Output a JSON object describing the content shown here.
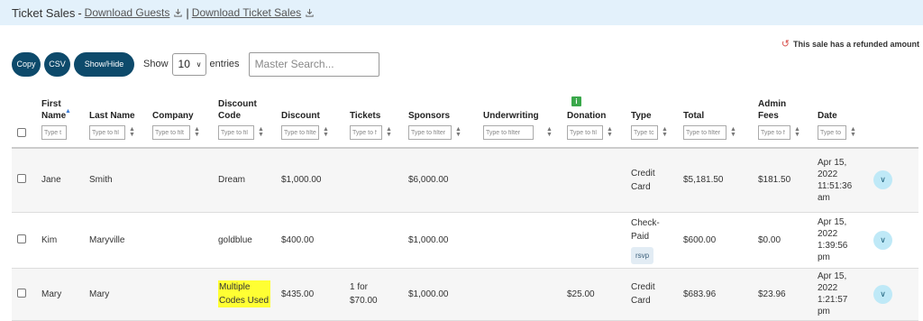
{
  "header": {
    "title": "Ticket Sales",
    "separator": " - ",
    "download_guests": "Download Guests",
    "pipe": "|",
    "download_ticket_sales": "Download Ticket Sales"
  },
  "refund_note": "This sale has a refunded amount",
  "toolbar": {
    "copy": "Copy",
    "csv": "CSV",
    "show_hide": "Show/Hide",
    "show_label": "Show",
    "entries_value": "10",
    "entries_label": "entries",
    "search_placeholder": "Master Search..."
  },
  "columns": [
    {
      "key": "first_name",
      "label": "First Name",
      "filter": "Type t"
    },
    {
      "key": "last_name",
      "label": "Last Name",
      "filter": "Type to fil"
    },
    {
      "key": "company",
      "label": "Company",
      "filter": "Type to filt"
    },
    {
      "key": "discount_code",
      "label": "Discount Code",
      "filter": "Type to fil"
    },
    {
      "key": "discount",
      "label": "Discount",
      "filter": "Type to filte"
    },
    {
      "key": "tickets",
      "label": "Tickets",
      "filter": "Type to f"
    },
    {
      "key": "sponsors",
      "label": "Sponsors",
      "filter": "Type to filter"
    },
    {
      "key": "underwriting",
      "label": "Underwriting",
      "filter": "Type to filter"
    },
    {
      "key": "donation",
      "label": "Donation",
      "filter": "Type to fil"
    },
    {
      "key": "type",
      "label": "Type",
      "filter": "Type tc"
    },
    {
      "key": "total",
      "label": "Total",
      "filter": "Type to filter"
    },
    {
      "key": "admin_fees",
      "label": "Admin Fees",
      "filter": "Type to f"
    },
    {
      "key": "date",
      "label": "Date",
      "filter": "Type to"
    }
  ],
  "rows": [
    {
      "first_name": "Jane",
      "last_name": "Smith",
      "company": "",
      "discount_code": "Dream",
      "discount": "$1,000.00",
      "tickets": "",
      "sponsors": "$6,000.00",
      "underwriting": "",
      "donation": "",
      "type": "Credit Card",
      "rsvp": "",
      "total": "$5,181.50",
      "admin_fees": "$181.50",
      "date": "Apr 15, 2022 11:51:36 am"
    },
    {
      "first_name": "Kim",
      "last_name": "Maryville",
      "company": "",
      "discount_code": "goldblue",
      "discount": "$400.00",
      "tickets": "",
      "sponsors": "$1,000.00",
      "underwriting": "",
      "donation": "",
      "type": "Check-Paid",
      "rsvp": "rsvp",
      "total": "$600.00",
      "admin_fees": "$0.00",
      "date": "Apr 15, 2022 1:39:56 pm"
    },
    {
      "first_name": "Mary",
      "last_name": "Mary",
      "company": "",
      "discount_code": "Multiple Codes Used",
      "discount": "$435.00",
      "tickets": "1 for $70.00",
      "sponsors": "$1,000.00",
      "underwriting": "",
      "donation": "$25.00",
      "type": "Credit Card",
      "rsvp": "",
      "total": "$683.96",
      "admin_fees": "$23.96",
      "date": "Apr 15, 2022 1:21:57 pm"
    }
  ],
  "icons": {
    "download": "download-icon",
    "refund": "undo-icon",
    "info": "info-icon",
    "expand": "chevron-down-icon"
  },
  "colors": {
    "header_bg": "#e3f1fb",
    "button_bg": "#0d4a6b",
    "expand_bg": "#bfe9f7",
    "info_green": "#3aa84b",
    "highlight": "#ffff33",
    "refund_red": "#d9534f"
  }
}
